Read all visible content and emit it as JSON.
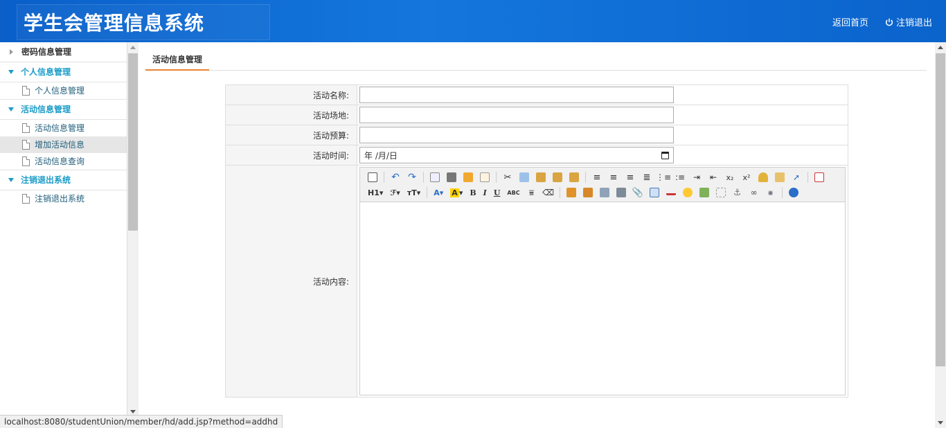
{
  "header": {
    "title": "学生会管理信息系统",
    "home_label": "返回首页",
    "logout_label": "注销退出"
  },
  "sidebar": {
    "groups": [
      {
        "label": "密码信息管理",
        "state": "collapsed",
        "items": []
      },
      {
        "label": "个人信息管理",
        "state": "open",
        "items": [
          {
            "label": "个人信息管理"
          }
        ]
      },
      {
        "label": "活动信息管理",
        "state": "open",
        "items": [
          {
            "label": "活动信息管理"
          },
          {
            "label": "增加活动信息"
          },
          {
            "label": "活动信息查询"
          }
        ]
      },
      {
        "label": "注销退出系统",
        "state": "open",
        "items": [
          {
            "label": "注销退出系统"
          }
        ]
      }
    ],
    "active_item": "增加活动信息"
  },
  "main": {
    "tab_label": "活动信息管理",
    "form": {
      "name_label": "活动名称:",
      "place_label": "活动场地:",
      "budget_label": "活动预算:",
      "time_label": "活动时间:",
      "time_placeholder": "年 /月/日",
      "content_label": "活动内容:"
    }
  },
  "editor_toolbar": {
    "row1": [
      "source-icon",
      "undo-icon",
      "redo-icon",
      "preview-icon",
      "print-icon",
      "template-icon",
      "code-icon",
      "cut-icon",
      "copy-icon",
      "paste-icon",
      "paste-text-icon",
      "paste-word-icon",
      "align-left-icon",
      "align-center-icon",
      "align-right-icon",
      "justify-icon",
      "ordered-list-icon",
      "unordered-list-icon",
      "indent-icon",
      "outdent-icon",
      "subscript-icon",
      "superscript-icon",
      "clear-format-icon",
      "select-all-icon",
      "pointer-icon",
      "fullscreen-icon"
    ],
    "row2": [
      "heading-button",
      "font-family-button",
      "font-size-button",
      "font-color-button",
      "highlight-color-button",
      "bold-button",
      "italic-button",
      "underline-button",
      "strikethrough-button",
      "line-height-button",
      "eraser-button",
      "image-icon",
      "multi-image-icon",
      "flash-icon",
      "media-icon",
      "attachment-icon",
      "table-icon",
      "horizontal-line-icon",
      "emoticon-icon",
      "map-icon",
      "pagebreak-icon",
      "anchor-icon",
      "link-icon",
      "unlink-icon",
      "help-icon"
    ],
    "heading_label": "H1",
    "font_size_label": "тT",
    "font_color_label": "A",
    "highlight_label": "A",
    "bold_label": "B",
    "italic_label": "I",
    "underline_label": "U",
    "strike_label": "ABC",
    "subscript_label": "x₂",
    "superscript_label": "x²"
  },
  "status_bar": {
    "url": "localhost:8080/studentUnion/member/hd/add.jsp?method=addhd"
  },
  "colors": {
    "header_blue": "#0a5fc9",
    "sidebar_accent": "#1a9cc9",
    "tab_underline": "#e8832f"
  }
}
